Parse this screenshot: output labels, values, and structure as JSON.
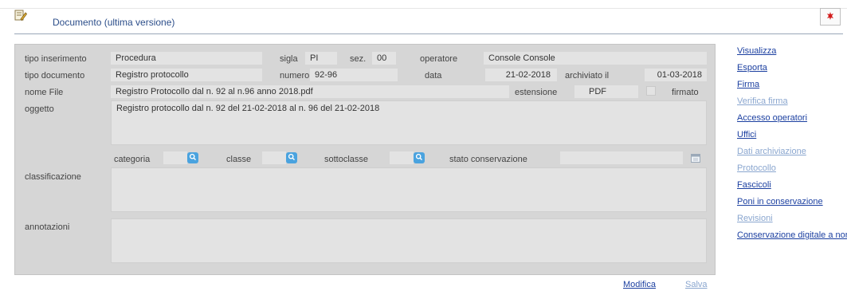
{
  "header": {
    "title": "Documento (ultima versione)"
  },
  "row1": {
    "tipo_inserimento_label": "tipo inserimento",
    "tipo_inserimento_value": "Procedura",
    "sigla_label": "sigla",
    "sigla_value": "PI",
    "sez_label": "sez.",
    "sez_value": "00",
    "operatore_label": "operatore",
    "operatore_value": "Console Console"
  },
  "row2": {
    "tipo_documento_label": "tipo documento",
    "tipo_documento_value": "Registro protocollo",
    "numero_label": "numero",
    "numero_value": "92-96",
    "data_label": "data",
    "data_value": "21-02-2018",
    "archiviato_label": "archiviato il",
    "archiviato_value": "01-03-2018"
  },
  "row3": {
    "nome_file_label": "nome File",
    "nome_file_value": "Registro Protocollo dal n. 92 al n.96 anno 2018.pdf",
    "estensione_label": "estensione",
    "estensione_value": "PDF",
    "firmato_label": "firmato"
  },
  "oggetto": {
    "label": "oggetto",
    "value": "Registro protocollo dal n. 92 del 21-02-2018 al n. 96 del 21-02-2018"
  },
  "class_row": {
    "categoria_label": "categoria",
    "classe_label": "classe",
    "sottoclasse_label": "sottoclasse",
    "stato_label": "stato conservazione"
  },
  "classificazione": {
    "label": "classificazione"
  },
  "annotazioni": {
    "label": "annotazioni"
  },
  "sidebar": {
    "items": [
      {
        "label": "Visualizza",
        "enabled": true
      },
      {
        "label": "Esporta",
        "enabled": true
      },
      {
        "label": "Firma",
        "enabled": true
      },
      {
        "label": "Verifica firma",
        "enabled": false
      },
      {
        "label": "Accesso operatori",
        "enabled": true
      },
      {
        "label": "Uffici",
        "enabled": true
      },
      {
        "label": "Dati archiviazione",
        "enabled": false
      },
      {
        "label": "Protocollo",
        "enabled": false
      },
      {
        "label": "Fascicoli",
        "enabled": true
      },
      {
        "label": "Poni in conservazione",
        "enabled": true
      },
      {
        "label": "Revisioni",
        "enabled": false
      },
      {
        "label": "Conservazione digitale a norma",
        "enabled": true
      }
    ]
  },
  "footer": {
    "modifica": "Modifica",
    "salva": "Salva"
  },
  "colors": {
    "link": "#1b3fa0",
    "link_disabled": "#8aa6cf",
    "panel": "#d6d6d6",
    "field": "#e3e3e3",
    "search_btn": "#4aa3df"
  },
  "icons": {
    "header": "document-edit-icon",
    "flag": "flag-icon",
    "search": "search-icon",
    "calendar": "calendar-icon"
  }
}
